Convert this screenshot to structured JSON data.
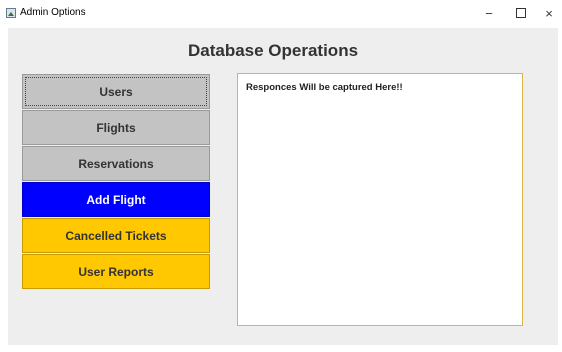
{
  "window": {
    "title": "Admin Options",
    "controls": {
      "minimize": "−",
      "close": "×"
    }
  },
  "main": {
    "heading": "Database Operations",
    "menu": [
      {
        "label": "Users",
        "style": "gray",
        "color": "#c3c3c3",
        "focused": true
      },
      {
        "label": "Flights",
        "style": "gray",
        "color": "#c3c3c3"
      },
      {
        "label": "Reservations",
        "style": "gray",
        "color": "#c3c3c3"
      },
      {
        "label": "Add Flight",
        "style": "blue",
        "color": "#0000ff"
      },
      {
        "label": "Cancelled Tickets",
        "style": "gold",
        "color": "#ffc800"
      },
      {
        "label": "User Reports",
        "style": "gold",
        "color": "#ffc800"
      }
    ],
    "response_text": "Responces Will be captured Here!!"
  }
}
